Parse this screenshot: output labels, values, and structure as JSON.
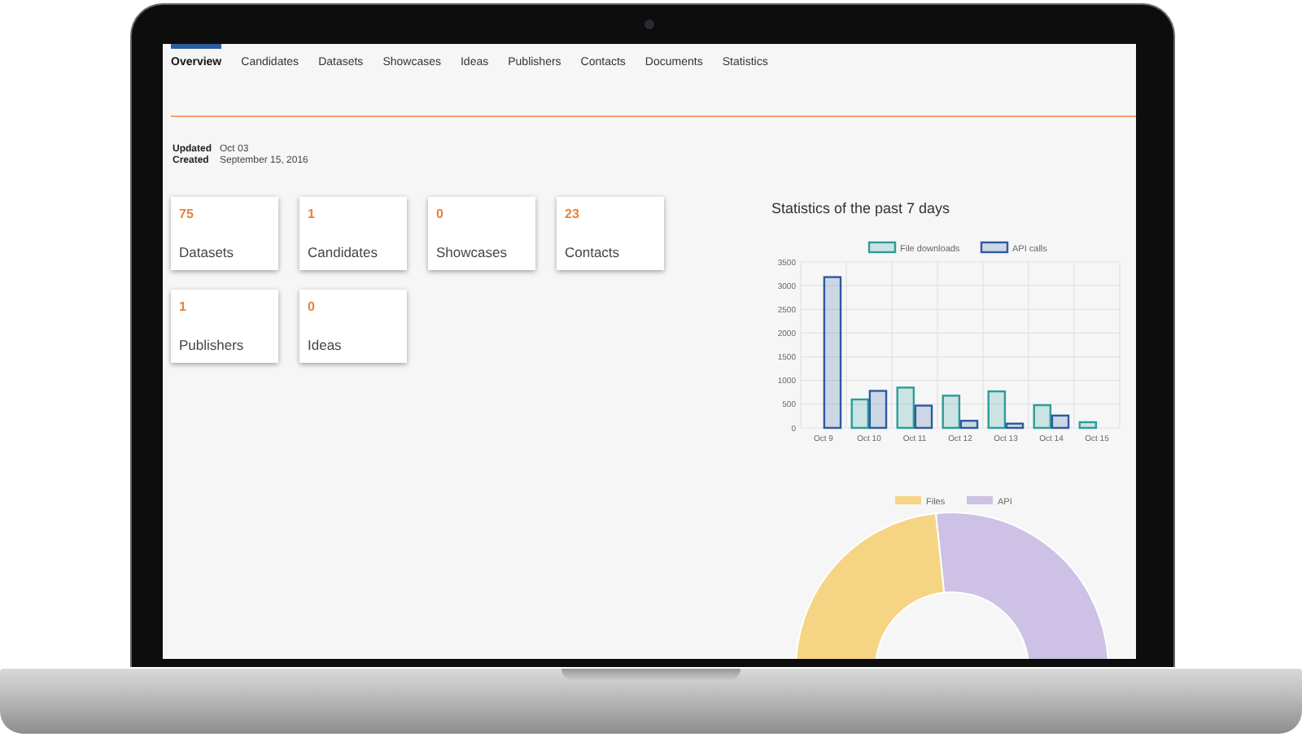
{
  "tabs": [
    {
      "label": "Overview",
      "selected": true
    },
    {
      "label": "Candidates",
      "selected": false
    },
    {
      "label": "Datasets",
      "selected": false
    },
    {
      "label": "Showcases",
      "selected": false
    },
    {
      "label": "Ideas",
      "selected": false
    },
    {
      "label": "Publishers",
      "selected": false
    },
    {
      "label": "Contacts",
      "selected": false
    },
    {
      "label": "Documents",
      "selected": false
    },
    {
      "label": "Statistics",
      "selected": false
    }
  ],
  "meta": [
    {
      "label": "Updated",
      "value": "Oct 03"
    },
    {
      "label": "Created",
      "value": "September 15, 2016"
    }
  ],
  "cards": [
    {
      "count": "75",
      "label": "Datasets"
    },
    {
      "count": "1",
      "label": "Candidates"
    },
    {
      "count": "0",
      "label": "Showcases"
    },
    {
      "count": "23",
      "label": "Contacts"
    },
    {
      "count": "1",
      "label": "Publishers"
    },
    {
      "count": "0",
      "label": "Ideas"
    }
  ],
  "statistics": {
    "title": "Statistics of the past 7 days",
    "chart_data": {
      "type": "bar",
      "grid": true,
      "legend": "top",
      "categories": [
        "Oct 9",
        "Oct 10",
        "Oct 11",
        "Oct 12",
        "Oct 13",
        "Oct 14",
        "Oct 15"
      ],
      "ylim": [
        0,
        3500
      ],
      "yticks": [
        0,
        500,
        1000,
        1500,
        2000,
        2500,
        3000,
        3500
      ],
      "series": [
        {
          "name": "File downloads",
          "color": "#2a9d9a",
          "values": [
            0,
            600,
            850,
            680,
            770,
            480,
            120
          ]
        },
        {
          "name": "API calls",
          "color": "#2d5aa0",
          "values": [
            3180,
            780,
            470,
            150,
            90,
            260,
            0
          ]
        }
      ]
    }
  },
  "usage": {
    "legend": [
      {
        "label": "Files",
        "color": "#f5d584"
      },
      {
        "label": "API",
        "color": "#cdc1e6"
      }
    ]
  }
}
